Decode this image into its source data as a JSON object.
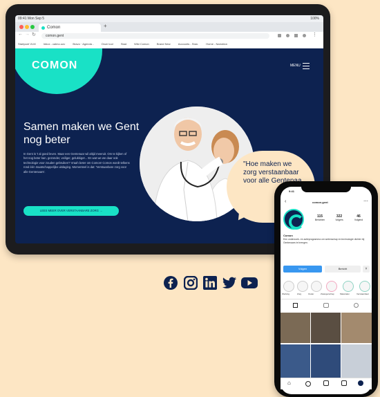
{
  "tablet": {
    "status_left": "09:41  Mon Sep 5",
    "status_right": "100%",
    "tab_title": "Comon",
    "url": "comon.gent",
    "bookmarks": [
      "Startpunt VLM",
      "Inbox - calmo.uov",
      "Bravo · Agenda -",
      "Onze tool",
      "Stad",
      "Wiki Comon",
      "Brand New",
      "Accounts - Stan.",
      "Home - Narration"
    ]
  },
  "site": {
    "logo": "COMON",
    "menu_label": "MENU",
    "headline": "Samen maken we Gent nog beter",
    "body": "In Gent is 't al goed leven. Maar een Gentenaar wil altijd meeruit. Om te kijken of het nog beter kan, gezonder, veiliger, gelukkiger... En wat we we daar ook technologie voor zouden gebruiken? Vraah beter om Comon! Comon wordt telkens rond één maatschappelijke uitdaging. Momenteel is dat: 'Verstaanbare zorg voor alle Gentenaars'.",
    "cta": "LEES MEER OVER VERSTAANBARE ZORG →",
    "quote": "\"Hoe maken we zorg verstaanbaar voor alle Gentenaa"
  },
  "social": [
    "facebook-icon",
    "instagram-icon",
    "linkedin-icon",
    "twitter-icon",
    "youtube-icon"
  ],
  "phone": {
    "time": "9:41",
    "username": "comon.gent",
    "stats": [
      {
        "value": "115",
        "label": "Berichten"
      },
      {
        "value": "322",
        "label": "Volgers"
      },
      {
        "value": "46",
        "label": "Volgend"
      }
    ],
    "bio_name": "Comon",
    "bio_text": "Een onderzoek- en actieprogramma om wetenschap en technologie dichter bij Gentenaars te brengen.",
    "follow_button": "Volgen",
    "message_button": "Bericht",
    "highlights": [
      "Werking",
      "Zorg",
      "Ouder",
      "Zwangerschap",
      "Materialen",
      "Verstaanbaar"
    ]
  },
  "colors": {
    "background": "#fde6c4",
    "navy": "#0d2250",
    "turquoise": "#19e1c6",
    "instagram_blue": "#3897f0"
  }
}
